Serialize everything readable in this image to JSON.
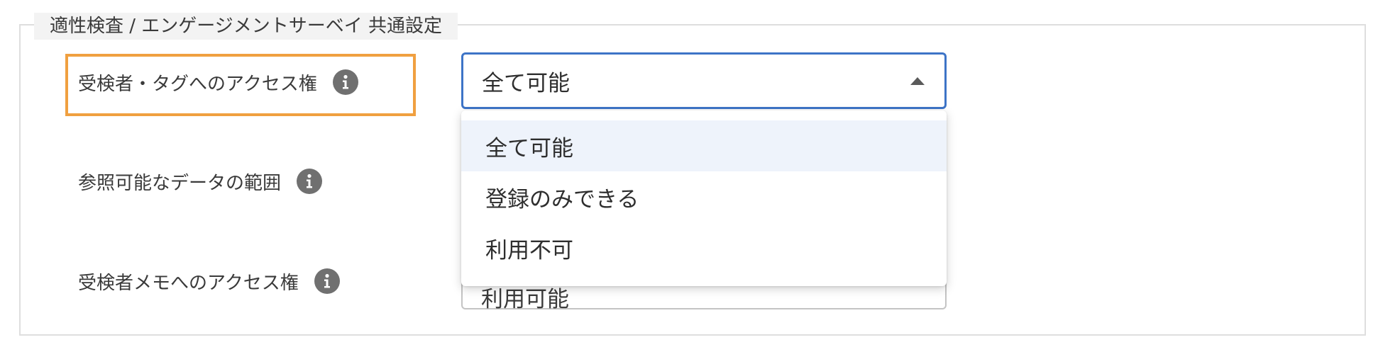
{
  "section": {
    "title": "適性検査 / エンゲージメントサーベイ 共通設定"
  },
  "rows": [
    {
      "label": "受検者・タグへのアクセス権",
      "icon": "info-icon",
      "value": "全て可能"
    },
    {
      "label": "参照可能なデータの範囲",
      "icon": "info-icon"
    },
    {
      "label": "受検者メモへのアクセス権",
      "icon": "info-icon",
      "value": "利用可能"
    }
  ],
  "dropdown": {
    "options": [
      {
        "label": "全て可能",
        "selected": true
      },
      {
        "label": "登録のみできる",
        "selected": false
      },
      {
        "label": "利用不可",
        "selected": false
      }
    ]
  },
  "colors": {
    "highlight": "#f0a040",
    "focus_border": "#3d74c7",
    "selected_option_bg": "#eef3fb",
    "icon_bg": "#707070"
  }
}
